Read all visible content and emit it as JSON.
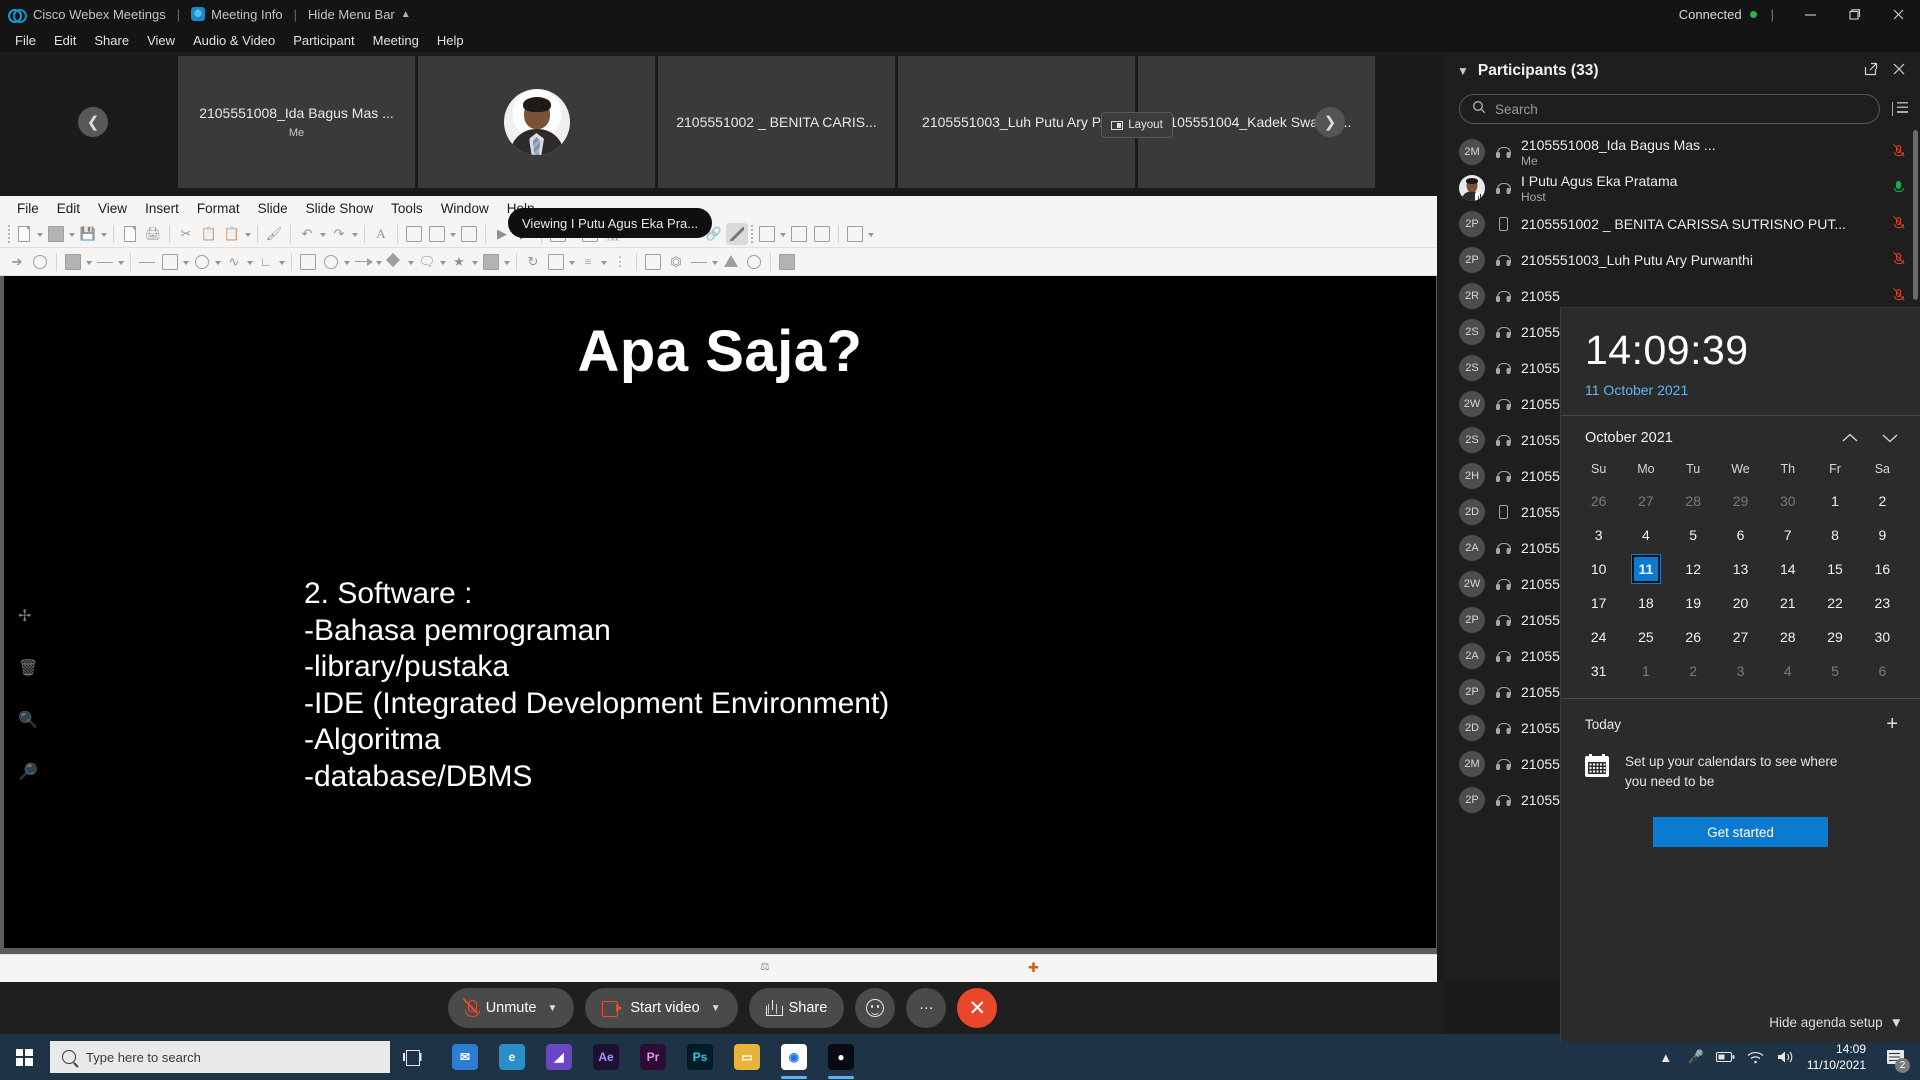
{
  "webex": {
    "app_title": "Cisco Webex Meetings",
    "meeting_info_label": "Meeting Info",
    "hide_menu_bar_label": "Hide Menu Bar",
    "connection_status": "Connected",
    "menu": [
      "File",
      "Edit",
      "Share",
      "View",
      "Audio & Video",
      "Participant",
      "Meeting",
      "Help"
    ],
    "layout_button": "Layout",
    "viewing_tooltip": "Viewing I Putu Agus Eka Pra..."
  },
  "filmstrip": [
    {
      "name": "2105551008_Ida Bagus Mas ...",
      "sub": "Me",
      "has_photo": false
    },
    {
      "name": "",
      "sub": "",
      "has_photo": true
    },
    {
      "name": "2105551002 _ BENITA CARIS...",
      "sub": "",
      "has_photo": false
    },
    {
      "name": "2105551003_Luh Putu Ary P...",
      "sub": "",
      "has_photo": false
    },
    {
      "name": "2105551004_Kadek Swasty ...",
      "sub": "",
      "has_photo": false
    }
  ],
  "impress": {
    "menu": [
      "File",
      "Edit",
      "View",
      "Insert",
      "Format",
      "Slide",
      "Slide Show",
      "Tools",
      "Window",
      "Help"
    ],
    "slide": {
      "title": "Apa Saja?",
      "body": "2. Software :\n-Bahasa pemrograman\n-library/pustaka\n-IDE (Integrated Development Environment)\n-Algoritma\n-database/DBMS"
    }
  },
  "controls": {
    "unmute": "Unmute",
    "start_video": "Start video",
    "share": "Share",
    "reactions_icon": "reaction-smiley-icon",
    "more_label": "···",
    "end_label": "✕"
  },
  "participants": {
    "title": "Participants (33)",
    "search_placeholder": "Search",
    "hide_agenda_label": "Hide agenda setup",
    "list": [
      {
        "initials": "2M",
        "name": "2105551008_Ida Bagus Mas ...",
        "sub": "Me",
        "device": "headset",
        "mic": "muted",
        "photo": false
      },
      {
        "initials": "",
        "name": "I Putu Agus Eka Pratama",
        "sub": "Host",
        "device": "headset",
        "mic": "active",
        "photo": true
      },
      {
        "initials": "2P",
        "name": "2105551002 _ BENITA CARISSA SUTRISNO PUT...",
        "sub": "",
        "device": "phone",
        "mic": "muted",
        "photo": false
      },
      {
        "initials": "2P",
        "name": "2105551003_Luh Putu Ary Purwanthi",
        "sub": "",
        "device": "headset",
        "mic": "muted",
        "photo": false
      },
      {
        "initials": "2R",
        "name": "21055",
        "sub": "",
        "device": "headset",
        "mic": "muted",
        "photo": false
      },
      {
        "initials": "2S",
        "name": "21055",
        "sub": "",
        "device": "headset",
        "mic": "muted",
        "photo": false
      },
      {
        "initials": "2S",
        "name": "21055",
        "sub": "",
        "device": "headset",
        "mic": "muted",
        "photo": false
      },
      {
        "initials": "2W",
        "name": "21055",
        "sub": "",
        "device": "headset",
        "mic": "muted",
        "photo": false
      },
      {
        "initials": "2S",
        "name": "21055",
        "sub": "",
        "device": "headset",
        "mic": "muted",
        "photo": false
      },
      {
        "initials": "2H",
        "name": "21055",
        "sub": "",
        "device": "headset",
        "mic": "muted",
        "photo": false
      },
      {
        "initials": "2D",
        "name": "21055",
        "sub": "",
        "device": "phone",
        "mic": "muted",
        "photo": false
      },
      {
        "initials": "2A",
        "name": "21055",
        "sub": "",
        "device": "headset",
        "mic": "muted",
        "photo": false
      },
      {
        "initials": "2W",
        "name": "21055",
        "sub": "",
        "device": "headset",
        "mic": "muted",
        "photo": false
      },
      {
        "initials": "2P",
        "name": "21055",
        "sub": "",
        "device": "headset",
        "mic": "muted",
        "photo": false
      },
      {
        "initials": "2A",
        "name": "21055",
        "sub": "",
        "device": "headset",
        "mic": "muted",
        "photo": false
      },
      {
        "initials": "2P",
        "name": "21055",
        "sub": "",
        "device": "headset",
        "mic": "muted",
        "photo": false
      },
      {
        "initials": "2D",
        "name": "21055",
        "sub": "",
        "device": "headset",
        "mic": "muted",
        "photo": false
      },
      {
        "initials": "2M",
        "name": "21055",
        "sub": "",
        "device": "headset",
        "mic": "muted",
        "photo": false
      },
      {
        "initials": "2P",
        "name": "21055",
        "sub": "",
        "device": "headset",
        "mic": "muted",
        "photo": false
      }
    ]
  },
  "calendar": {
    "time": "14:09:39",
    "date": "11 October 2021",
    "month_label": "October 2021",
    "dow": [
      "Su",
      "Mo",
      "Tu",
      "We",
      "Th",
      "Fr",
      "Sa"
    ],
    "weeks": [
      [
        {
          "d": "26",
          "dim": true
        },
        {
          "d": "27",
          "dim": true
        },
        {
          "d": "28",
          "dim": true
        },
        {
          "d": "29",
          "dim": true
        },
        {
          "d": "30",
          "dim": true
        },
        {
          "d": "1",
          "dim": false
        },
        {
          "d": "2",
          "dim": false
        }
      ],
      [
        {
          "d": "3",
          "dim": false
        },
        {
          "d": "4",
          "dim": false
        },
        {
          "d": "5",
          "dim": false
        },
        {
          "d": "6",
          "dim": false
        },
        {
          "d": "7",
          "dim": false
        },
        {
          "d": "8",
          "dim": false
        },
        {
          "d": "9",
          "dim": false
        }
      ],
      [
        {
          "d": "10",
          "dim": false
        },
        {
          "d": "11",
          "dim": false,
          "selected": true
        },
        {
          "d": "12",
          "dim": false
        },
        {
          "d": "13",
          "dim": false
        },
        {
          "d": "14",
          "dim": false
        },
        {
          "d": "15",
          "dim": false
        },
        {
          "d": "16",
          "dim": false
        }
      ],
      [
        {
          "d": "17",
          "dim": false
        },
        {
          "d": "18",
          "dim": false
        },
        {
          "d": "19",
          "dim": false
        },
        {
          "d": "20",
          "dim": false
        },
        {
          "d": "21",
          "dim": false
        },
        {
          "d": "22",
          "dim": false
        },
        {
          "d": "23",
          "dim": false
        }
      ],
      [
        {
          "d": "24",
          "dim": false
        },
        {
          "d": "25",
          "dim": false
        },
        {
          "d": "26",
          "dim": false
        },
        {
          "d": "27",
          "dim": false
        },
        {
          "d": "28",
          "dim": false
        },
        {
          "d": "29",
          "dim": false
        },
        {
          "d": "30",
          "dim": false
        }
      ],
      [
        {
          "d": "31",
          "dim": false
        },
        {
          "d": "1",
          "dim": true
        },
        {
          "d": "2",
          "dim": true
        },
        {
          "d": "3",
          "dim": true
        },
        {
          "d": "4",
          "dim": true
        },
        {
          "d": "5",
          "dim": true
        },
        {
          "d": "6",
          "dim": true
        }
      ]
    ],
    "today_label": "Today",
    "agenda_text": "Set up your calendars to see where you need to be",
    "get_started_label": "Get started",
    "accent_color": "#0a7bd1"
  },
  "taskbar": {
    "search_placeholder": "Type here to search",
    "clock_time": "14:09",
    "clock_date": "11/10/2021",
    "notification_count": "2",
    "apps": [
      {
        "name": "mail-icon",
        "label": "✉",
        "color": "#2d7dd2"
      },
      {
        "name": "edge-icon",
        "label": "e",
        "color": "#2a8fc9"
      },
      {
        "name": "wondershare-icon",
        "label": "◢",
        "color": "#6b46c1"
      },
      {
        "name": "after-effects-icon",
        "label": "Ae",
        "color": "#1f1033"
      },
      {
        "name": "premiere-pro-icon",
        "label": "Pr",
        "color": "#2a0d33"
      },
      {
        "name": "photoshop-icon",
        "label": "Ps",
        "color": "#001d26"
      },
      {
        "name": "file-explorer-icon",
        "label": "▭",
        "color": "#e8b33a"
      },
      {
        "name": "chrome-icon",
        "label": "◉",
        "color": "#ffffff"
      },
      {
        "name": "webex-icon",
        "label": "●",
        "color": "#0a0a14"
      }
    ]
  }
}
